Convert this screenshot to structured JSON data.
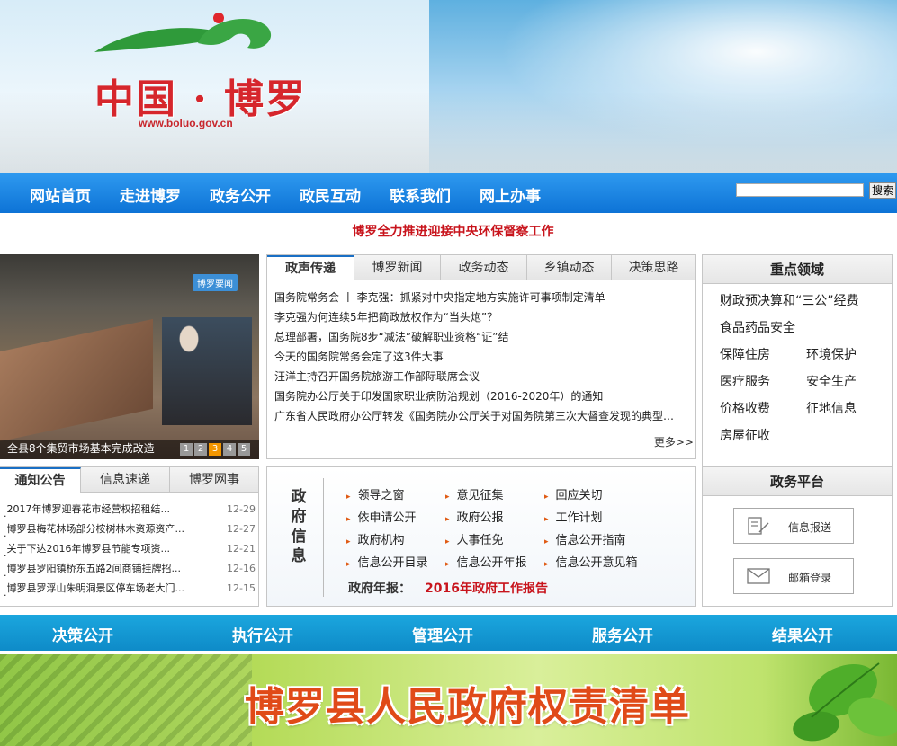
{
  "site": {
    "title": "中国 · 博罗",
    "url": "www.boluo.gov.cn"
  },
  "nav": {
    "items": [
      "网站首页",
      "走进博罗",
      "政务公开",
      "政民互动",
      "联系我们",
      "网上办事"
    ],
    "search_value": "",
    "search_button": "搜索"
  },
  "headline": "博罗全力推进迎接中央环保督察工作",
  "photo": {
    "tag": "博罗要闻",
    "caption": "全县8个集贸市场基本完成改造",
    "pages": [
      "1",
      "2",
      "3",
      "4",
      "5"
    ],
    "active_page": 3
  },
  "news": {
    "tabs": [
      "政声传递",
      "博罗新闻",
      "政务动态",
      "乡镇动态",
      "决策思路"
    ],
    "active_tab": 0,
    "items": [
      "国务院常务会 丨 李克强：抓紧对中央指定地方实施许可事项制定清单",
      "李克强为何连续5年把简政放权作为“当头炮”？",
      "总理部署，国务院8步“减法”破解职业资格“证”结",
      "今天的国务院常务会定了这3件大事",
      "汪洋主持召开国务院旅游工作部际联席会议",
      "国务院办公厅关于印发国家职业病防治规划（2016-2020年）的通知",
      "广东省人民政府办公厅转发《国务院办公厅关于对国务院第三次大督查发现的典型…"
    ],
    "more": "更多>>"
  },
  "key_areas": {
    "title": "重点领域",
    "items": [
      "财政预决算和“三公”经费",
      "食品药品安全",
      "保障住房",
      "环境保护",
      "医疗服务",
      "安全生产",
      "价格收费",
      "征地信息",
      "房屋征收"
    ]
  },
  "notice": {
    "tabs": [
      "通知公告",
      "信息速递",
      "博罗网事"
    ],
    "active_tab": 0,
    "items": [
      {
        "title": "2017年博罗迎春花市经营权招租结...",
        "date": "12-29"
      },
      {
        "title": "博罗县梅花林场部分桉树林木资源资产...",
        "date": "12-27"
      },
      {
        "title": "关于下达2016年博罗县节能专项资...",
        "date": "12-21"
      },
      {
        "title": "博罗县罗阳镇桥东五路2间商铺挂牌招...",
        "date": "12-16"
      },
      {
        "title": "博罗县罗浮山朱明洞景区停车场老大门...",
        "date": "12-15"
      }
    ]
  },
  "gov_info": {
    "side": [
      "政",
      "府",
      "信",
      "息"
    ],
    "links": [
      "领导之窗",
      "意见征集",
      "回应关切",
      "依申请公开",
      "政府公报",
      "工作计划",
      "政府机构",
      "人事任免",
      "信息公开指南",
      "信息公开目录",
      "信息公开年报",
      "信息公开意见箱"
    ],
    "report_label": "政府年报：",
    "report_link": "2016年政府工作报告"
  },
  "platform": {
    "title": "政务平台",
    "buttons": [
      "信息报送",
      "邮箱登录"
    ]
  },
  "bluebar": [
    "决策公开",
    "执行公开",
    "管理公开",
    "服务公开",
    "结果公开"
  ],
  "bottom_banner": "博罗县人民政府权责清单",
  "colors": {
    "nav_blue": "#0d73d6",
    "headline_red": "#c8141c",
    "bar_cyan": "#0e8bc8",
    "banner_orange": "#e04a18"
  }
}
